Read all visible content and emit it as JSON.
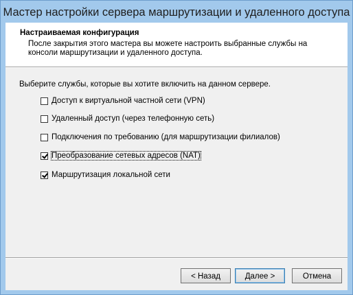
{
  "window": {
    "title": "Мастер настройки сервера маршрутизации и удаленного доступа"
  },
  "header": {
    "title": "Настраиваемая конфигурация",
    "description": "После закрытия этого мастера вы можете настроить выбранные службы на консоли маршрутизации и удаленного доступа."
  },
  "prompt": "Выберите службы, которые вы хотите включить на данном сервере.",
  "options": [
    {
      "label": "Доступ к виртуальной частной сети (VPN)",
      "checked": false
    },
    {
      "label": "Удаленный доступ (через телефонную сеть)",
      "checked": false
    },
    {
      "label": "Подключения по требованию (для маршрутизации филиалов)",
      "checked": false
    },
    {
      "label": "Преобразование сетевых адресов (NAT)",
      "checked": true
    },
    {
      "label": "Маршрутизация локальной сети",
      "checked": true
    }
  ],
  "buttons": {
    "back": "< Назад",
    "next": "Далее >",
    "cancel": "Отмена"
  }
}
